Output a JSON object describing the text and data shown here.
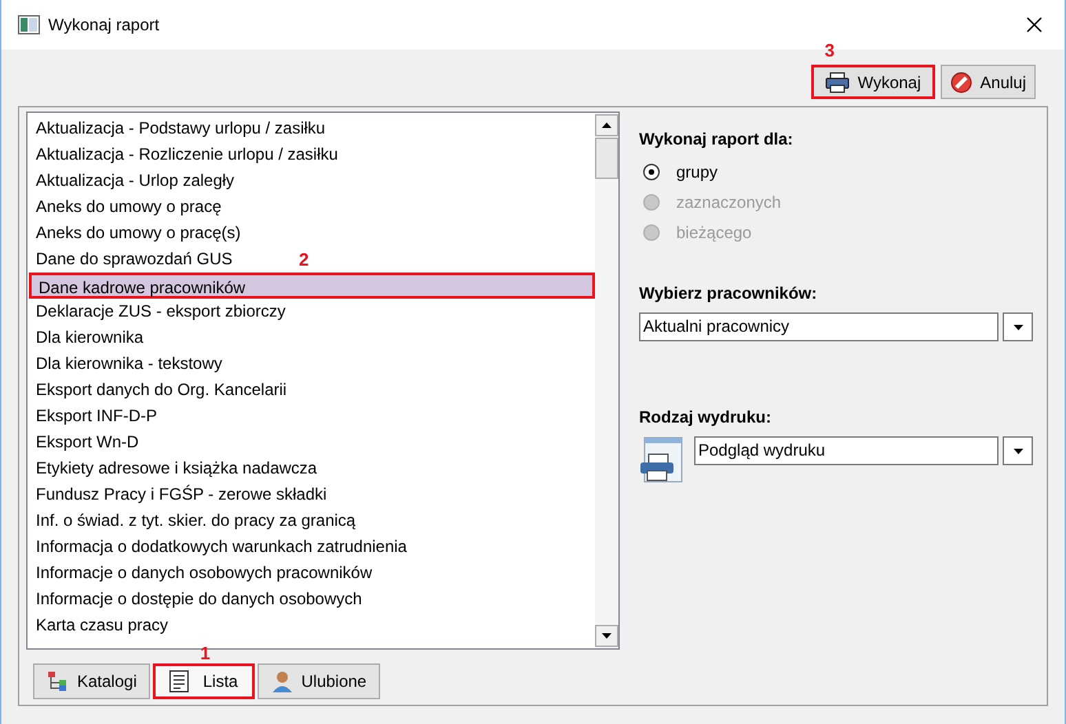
{
  "window": {
    "title": "Wykonaj raport"
  },
  "toolbar": [
    {
      "kind": "run",
      "label": "Wykonaj",
      "annotation": "3"
    },
    {
      "kind": "cancel",
      "label": "Anuluj"
    }
  ],
  "report_list": {
    "items": [
      {
        "label": "Aktualizacja - Podstawy urlopu / zasiłku",
        "selected": false
      },
      {
        "label": "Aktualizacja - Rozliczenie urlopu / zasiłku",
        "selected": false
      },
      {
        "label": "Aktualizacja - Urlop zaległy",
        "selected": false
      },
      {
        "label": "Aneks do umowy o pracę",
        "selected": false
      },
      {
        "label": "Aneks do umowy o pracę(s)",
        "selected": false
      },
      {
        "label": "Dane do sprawozdań GUS",
        "selected": false
      },
      {
        "label": "Dane kadrowe pracowników",
        "selected": true,
        "annotation": "2"
      },
      {
        "label": "Deklaracje ZUS - eksport zbiorczy",
        "selected": false
      },
      {
        "label": "Dla kierownika",
        "selected": false
      },
      {
        "label": "Dla kierownika - tekstowy",
        "selected": false
      },
      {
        "label": "Eksport danych do Org. Kancelarii",
        "selected": false
      },
      {
        "label": "Eksport INF-D-P",
        "selected": false
      },
      {
        "label": "Eksport Wn-D",
        "selected": false
      },
      {
        "label": "Etykiety adresowe i książka nadawcza",
        "selected": false
      },
      {
        "label": "Fundusz Pracy i FGŚP - zerowe składki",
        "selected": false
      },
      {
        "label": "Inf. o świad. z tyt. skier. do pracy za granicą",
        "selected": false
      },
      {
        "label": "Informacja o dodatkowych warunkach zatrudnienia",
        "selected": false
      },
      {
        "label": "Informacje o danych osobowych pracowników",
        "selected": false
      },
      {
        "label": "Informacje o dostępie do danych osobowych",
        "selected": false
      },
      {
        "label": "Karta czasu pracy",
        "selected": false
      }
    ]
  },
  "tabs": [
    {
      "kind": "tree",
      "label": "Katalogi",
      "selected": false
    },
    {
      "kind": "list",
      "label": "Lista",
      "selected": true,
      "annotation": "1"
    },
    {
      "kind": "person",
      "label": "Ulubione",
      "selected": false
    }
  ],
  "run_for": {
    "label": "Wykonaj raport dla:",
    "options": [
      {
        "label": "grupy",
        "selected": true,
        "disabled": false
      },
      {
        "label": "zaznaczonych",
        "selected": false,
        "disabled": true
      },
      {
        "label": "bieżącego",
        "selected": false,
        "disabled": true
      }
    ]
  },
  "employees": {
    "label": "Wybierz pracowników:",
    "value": "Aktualni pracownicy"
  },
  "print_type": {
    "label": "Rodzaj wydruku:",
    "value": "Podgląd wydruku"
  }
}
